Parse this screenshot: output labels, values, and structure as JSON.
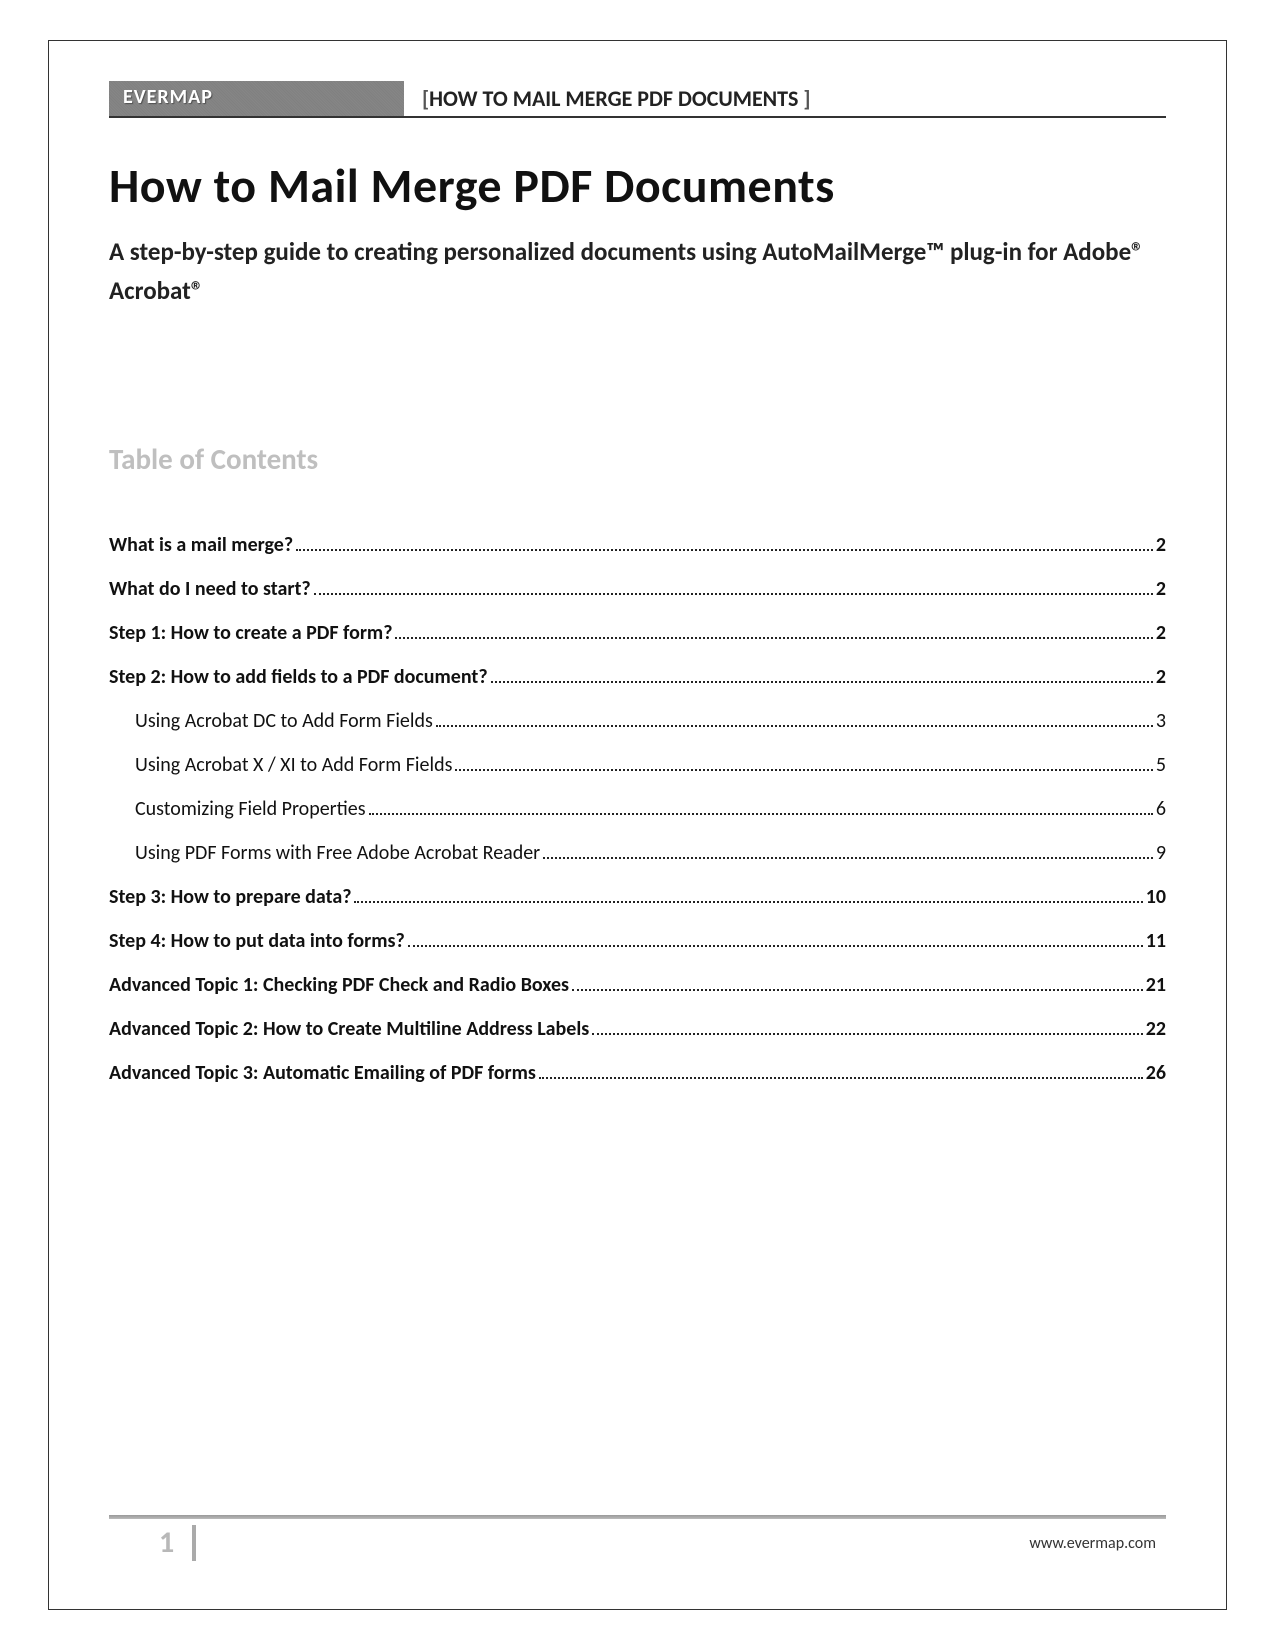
{
  "header": {
    "brand": "EVERMAP",
    "title_prefix": "[",
    "title": "HOW TO MAIL MERGE PDF DOCUMENTS ",
    "title_suffix": "]"
  },
  "document": {
    "title": "How to Mail Merge PDF Documents",
    "subtitle": "A step-by-step guide to creating personalized documents using AutoMailMerge™ plug-in for Adobe® Acrobat®"
  },
  "toc": {
    "heading": "Table of Contents",
    "entries": [
      {
        "level": 1,
        "text": "What is a mail merge?",
        "page": "2"
      },
      {
        "level": 1,
        "text": "What do I need to start? ",
        "page": "2"
      },
      {
        "level": 1,
        "text": "Step 1: How to create a PDF form? ",
        "page": "2"
      },
      {
        "level": 1,
        "text": "Step 2: How to add fields to a PDF document?",
        "page": "2"
      },
      {
        "level": 2,
        "text": "Using Acrobat DC to Add Form Fields",
        "page": "3"
      },
      {
        "level": 2,
        "text": "Using Acrobat X / XI to Add Form Fields",
        "page": "5"
      },
      {
        "level": 2,
        "text": "Customizing Field Properties ",
        "page": "6"
      },
      {
        "level": 2,
        "text": "Using PDF Forms with Free Adobe Acrobat Reader ",
        "page": "9"
      },
      {
        "level": 1,
        "text": "Step 3: How to prepare data?",
        "page": "10"
      },
      {
        "level": 1,
        "text": "Step 4: How to put data into forms? ",
        "page": "11"
      },
      {
        "level": 1,
        "text": "Advanced Topic 1: Checking PDF Check and Radio Boxes",
        "page": "21"
      },
      {
        "level": 1,
        "text": "Advanced Topic 2: How to Create Multiline Address Labels",
        "page": "22"
      },
      {
        "level": 1,
        "text": "Advanced Topic 3: Automatic Emailing of PDF forms",
        "page": "26"
      }
    ]
  },
  "footer": {
    "page_number": "1",
    "url": "www.evermap.com"
  }
}
